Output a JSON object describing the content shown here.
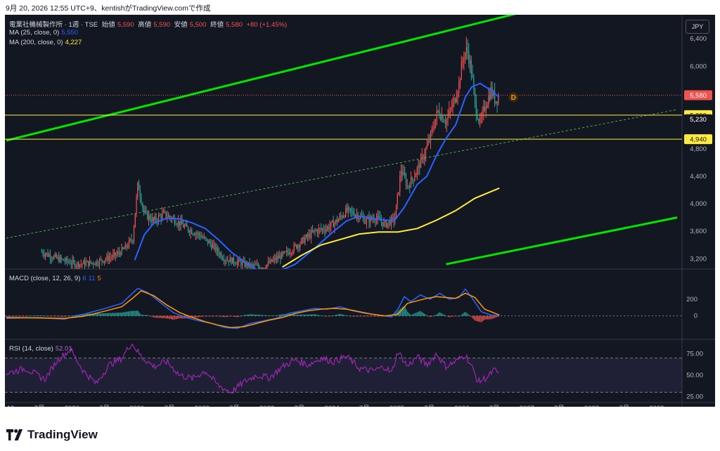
{
  "header": {
    "text": "9月 20, 2026 12:55 UTC+9、kentishがTradingView.comで作成"
  },
  "legend": {
    "title": "電業社機械製作所 · 1週 · TSE",
    "open_label": "始値",
    "open": "5,590",
    "high_label": "高値",
    "high": "5,590",
    "low_label": "安値",
    "low": "5,500",
    "close_label": "終値",
    "close": "5,580",
    "change": "+80 (+1.45%)",
    "ma25_label": "MA (25, close, 0)",
    "ma25_value": "5,550",
    "ma200_label": "MA (200, close, 0)",
    "ma200_value": "4,227"
  },
  "currency_button": "JPY",
  "macd_legend": {
    "label": "MACD (close, 12, 26, 9)",
    "v1": "6",
    "v2": "11",
    "v3": "5"
  },
  "rsi_legend": {
    "label": "RSI (14, close)",
    "value": "52.01"
  },
  "brand": "TradingView",
  "colors": {
    "bg": "#131722",
    "up": "#ef5350",
    "down": "#26a69a",
    "ma25": "#2962ff",
    "ma200": "#ffeb3b",
    "channel": "#00e600",
    "macd": "#2962ff",
    "signal": "#ff9800",
    "rsi": "#9c27b0"
  },
  "chart_data": {
    "type": "candlestick",
    "price_axis_ticks": [
      "6,400",
      "6,000",
      "5,600",
      "4,800",
      "4,400",
      "4,000",
      "3,600",
      "3,200"
    ],
    "price_labels": [
      {
        "value": 5580,
        "text": "5,580",
        "color": "#ef5350"
      },
      {
        "value": 5290,
        "text": "5,290",
        "color": "#ffeb3b"
      },
      {
        "value": 4940,
        "text": "4,940",
        "color": "#ffeb3b"
      },
      {
        "value": 5230,
        "text": "5,230",
        "color": "#131722"
      }
    ],
    "horizontal_lines": [
      5290,
      4940
    ],
    "annotation": "D",
    "price_range": [
      3050,
      6750
    ],
    "x_axis_labels": [
      "19",
      "7月",
      "2020",
      "7月",
      "2021",
      "7月",
      "2022",
      "7月",
      "2023",
      "7月",
      "2024",
      "7月",
      "2025",
      "7月",
      "2026",
      "7月",
      "2027",
      "7月",
      "2028",
      "7月",
      "2029"
    ],
    "price_path": [
      [
        2019.55,
        3300
      ],
      [
        2019.8,
        3200
      ],
      [
        2020.1,
        3120
      ],
      [
        2020.4,
        3150
      ],
      [
        2020.7,
        3250
      ],
      [
        2020.85,
        3350
      ],
      [
        2020.97,
        3500
      ],
      [
        2021.05,
        4300
      ],
      [
        2021.15,
        3850
      ],
      [
        2021.3,
        3750
      ],
      [
        2021.45,
        3850
      ],
      [
        2021.6,
        3780
      ],
      [
        2021.8,
        3650
      ],
      [
        2022.0,
        3550
      ],
      [
        2022.2,
        3400
      ],
      [
        2022.4,
        3200
      ],
      [
        2022.6,
        3150
      ],
      [
        2022.8,
        3100
      ],
      [
        2023.0,
        3080
      ],
      [
        2023.2,
        3200
      ],
      [
        2023.4,
        3300
      ],
      [
        2023.6,
        3450
      ],
      [
        2023.8,
        3600
      ],
      [
        2024.0,
        3650
      ],
      [
        2024.15,
        3750
      ],
      [
        2024.3,
        3900
      ],
      [
        2024.45,
        3850
      ],
      [
        2024.6,
        3750
      ],
      [
        2024.75,
        3800
      ],
      [
        2024.9,
        3700
      ],
      [
        2025.05,
        3780
      ],
      [
        2025.15,
        4500
      ],
      [
        2025.25,
        4250
      ],
      [
        2025.35,
        4400
      ],
      [
        2025.5,
        4700
      ],
      [
        2025.6,
        4950
      ],
      [
        2025.72,
        5350
      ],
      [
        2025.85,
        5200
      ],
      [
        2025.98,
        5500
      ],
      [
        2026.05,
        5750
      ],
      [
        2026.12,
        6150
      ],
      [
        2026.18,
        6250
      ],
      [
        2026.25,
        5900
      ],
      [
        2026.3,
        5450
      ],
      [
        2026.38,
        5150
      ],
      [
        2026.45,
        5400
      ],
      [
        2026.55,
        5650
      ],
      [
        2026.62,
        5500
      ],
      [
        2026.68,
        5580
      ]
    ],
    "ma25": [
      [
        2021.0,
        3180
      ],
      [
        2021.15,
        3550
      ],
      [
        2021.3,
        3720
      ],
      [
        2021.5,
        3790
      ],
      [
        2021.7,
        3780
      ],
      [
        2021.9,
        3720
      ],
      [
        2022.1,
        3640
      ],
      [
        2022.3,
        3480
      ],
      [
        2022.5,
        3300
      ],
      [
        2022.7,
        3160
      ],
      [
        2022.9,
        3040
      ],
      [
        2023.2,
        3000
      ],
      [
        2023.5,
        3120
      ],
      [
        2023.8,
        3350
      ],
      [
        2024.1,
        3600
      ],
      [
        2024.3,
        3750
      ],
      [
        2024.5,
        3820
      ],
      [
        2024.7,
        3790
      ],
      [
        2024.9,
        3760
      ],
      [
        2025.05,
        3760
      ],
      [
        2025.2,
        3950
      ],
      [
        2025.4,
        4280
      ],
      [
        2025.55,
        4400
      ],
      [
        2025.7,
        4700
      ],
      [
        2025.85,
        4950
      ],
      [
        2026.0,
        5150
      ],
      [
        2026.15,
        5550
      ],
      [
        2026.25,
        5700
      ],
      [
        2026.38,
        5750
      ],
      [
        2026.5,
        5680
      ],
      [
        2026.68,
        5550
      ]
    ],
    "ma200": [
      [
        2023.3,
        3080
      ],
      [
        2023.6,
        3250
      ],
      [
        2023.9,
        3400
      ],
      [
        2024.2,
        3480
      ],
      [
        2024.5,
        3560
      ],
      [
        2024.8,
        3590
      ],
      [
        2025.1,
        3590
      ],
      [
        2025.4,
        3640
      ],
      [
        2025.7,
        3760
      ],
      [
        2026.0,
        3900
      ],
      [
        2026.3,
        4080
      ],
      [
        2026.68,
        4227
      ]
    ],
    "channel_upper": [
      [
        2019.0,
        4920
      ],
      [
        2027.95,
        7000
      ]
    ],
    "channel_lower": [
      [
        2025.85,
        3120
      ],
      [
        2029.45,
        3800
      ]
    ],
    "channel_mid": [
      [
        2019.0,
        3500
      ],
      [
        2029.45,
        5370
      ]
    ],
    "macd_axis_ticks": [
      "200",
      "0"
    ],
    "macd_range": [
      -280,
      560
    ],
    "macd_line": [
      [
        2019.0,
        -30
      ],
      [
        2019.5,
        -20
      ],
      [
        2019.9,
        -40
      ],
      [
        2020.2,
        20
      ],
      [
        2020.5,
        80
      ],
      [
        2020.8,
        150
      ],
      [
        2020.95,
        260
      ],
      [
        2021.05,
        330
      ],
      [
        2021.2,
        280
      ],
      [
        2021.4,
        160
      ],
      [
        2021.6,
        40
      ],
      [
        2021.8,
        -20
      ],
      [
        2022.0,
        -60
      ],
      [
        2022.2,
        -90
      ],
      [
        2022.4,
        -140
      ],
      [
        2022.6,
        -150
      ],
      [
        2022.8,
        -90
      ],
      [
        2023.0,
        -60
      ],
      [
        2023.2,
        -30
      ],
      [
        2023.4,
        30
      ],
      [
        2023.6,
        60
      ],
      [
        2023.8,
        90
      ],
      [
        2024.0,
        80
      ],
      [
        2024.2,
        110
      ],
      [
        2024.4,
        60
      ],
      [
        2024.6,
        30
      ],
      [
        2024.8,
        10
      ],
      [
        2025.0,
        -10
      ],
      [
        2025.1,
        80
      ],
      [
        2025.2,
        230
      ],
      [
        2025.3,
        170
      ],
      [
        2025.45,
        250
      ],
      [
        2025.6,
        200
      ],
      [
        2025.75,
        270
      ],
      [
        2025.9,
        200
      ],
      [
        2026.05,
        220
      ],
      [
        2026.15,
        320
      ],
      [
        2026.25,
        220
      ],
      [
        2026.4,
        50
      ],
      [
        2026.55,
        10
      ],
      [
        2026.68,
        6
      ]
    ],
    "signal_line": [
      [
        2019.0,
        -20
      ],
      [
        2019.5,
        -25
      ],
      [
        2019.9,
        -30
      ],
      [
        2020.2,
        -5
      ],
      [
        2020.5,
        50
      ],
      [
        2020.8,
        110
      ],
      [
        2020.95,
        200
      ],
      [
        2021.1,
        300
      ],
      [
        2021.3,
        240
      ],
      [
        2021.5,
        130
      ],
      [
        2021.7,
        40
      ],
      [
        2021.9,
        -20
      ],
      [
        2022.1,
        -70
      ],
      [
        2022.3,
        -110
      ],
      [
        2022.5,
        -140
      ],
      [
        2022.7,
        -130
      ],
      [
        2022.9,
        -90
      ],
      [
        2023.1,
        -50
      ],
      [
        2023.3,
        -20
      ],
      [
        2023.5,
        30
      ],
      [
        2023.7,
        60
      ],
      [
        2023.9,
        80
      ],
      [
        2024.1,
        90
      ],
      [
        2024.3,
        80
      ],
      [
        2024.5,
        50
      ],
      [
        2024.7,
        20
      ],
      [
        2024.9,
        0
      ],
      [
        2025.1,
        20
      ],
      [
        2025.25,
        150
      ],
      [
        2025.4,
        180
      ],
      [
        2025.55,
        210
      ],
      [
        2025.7,
        230
      ],
      [
        2025.85,
        220
      ],
      [
        2026.0,
        210
      ],
      [
        2026.15,
        270
      ],
      [
        2026.3,
        220
      ],
      [
        2026.45,
        80
      ],
      [
        2026.68,
        11
      ]
    ],
    "rsi_axis_ticks": [
      "75.00",
      "50.00",
      "25.00"
    ],
    "rsi_range": [
      18,
      92
    ],
    "rsi_bands": [
      70,
      30
    ],
    "rsi_line": [
      [
        2019.0,
        52
      ],
      [
        2019.3,
        58
      ],
      [
        2019.6,
        45
      ],
      [
        2019.8,
        68
      ],
      [
        2020.0,
        80
      ],
      [
        2020.2,
        55
      ],
      [
        2020.4,
        40
      ],
      [
        2020.6,
        62
      ],
      [
        2020.8,
        70
      ],
      [
        2020.95,
        88
      ],
      [
        2021.1,
        72
      ],
      [
        2021.3,
        60
      ],
      [
        2021.5,
        66
      ],
      [
        2021.7,
        50
      ],
      [
        2021.9,
        46
      ],
      [
        2022.1,
        55
      ],
      [
        2022.3,
        38
      ],
      [
        2022.5,
        30
      ],
      [
        2022.7,
        42
      ],
      [
        2022.9,
        50
      ],
      [
        2023.1,
        47
      ],
      [
        2023.3,
        60
      ],
      [
        2023.5,
        68
      ],
      [
        2023.7,
        62
      ],
      [
        2023.9,
        70
      ],
      [
        2024.1,
        66
      ],
      [
        2024.3,
        72
      ],
      [
        2024.5,
        58
      ],
      [
        2024.7,
        55
      ],
      [
        2024.9,
        60
      ],
      [
        2025.0,
        52
      ],
      [
        2025.1,
        78
      ],
      [
        2025.25,
        60
      ],
      [
        2025.4,
        72
      ],
      [
        2025.55,
        62
      ],
      [
        2025.7,
        75
      ],
      [
        2025.85,
        60
      ],
      [
        2026.0,
        66
      ],
      [
        2026.15,
        74
      ],
      [
        2026.25,
        60
      ],
      [
        2026.35,
        42
      ],
      [
        2026.5,
        48
      ],
      [
        2026.6,
        56
      ],
      [
        2026.68,
        52
      ]
    ]
  }
}
